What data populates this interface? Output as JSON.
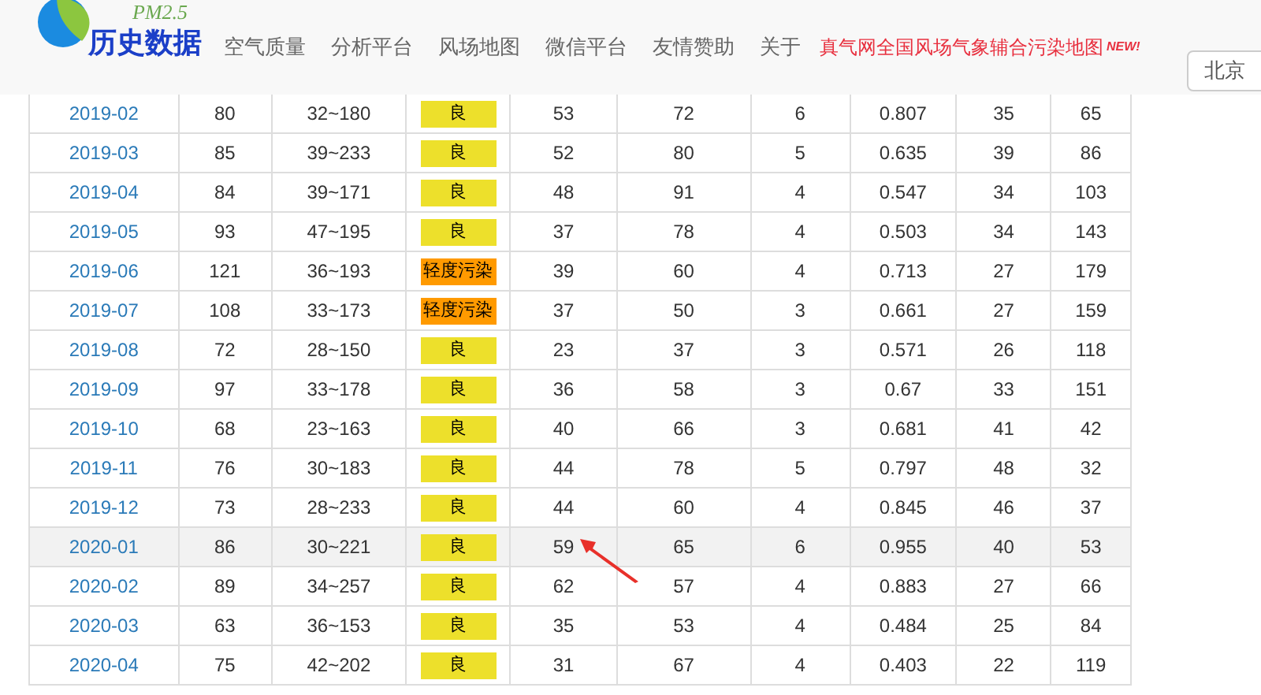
{
  "logo": {
    "caption": "PM2.5",
    "title": "历史数据"
  },
  "nav": [
    "空气质量",
    "分析平台",
    "风场地图",
    "微信平台",
    "友情赞助",
    "关于"
  ],
  "promo": {
    "text": "真气网全国风场气象辅合污染地图",
    "badge": "NEW!"
  },
  "city": {
    "value": "北京"
  },
  "rows": [
    {
      "month": "2019-02",
      "cells": [
        "80",
        "32~180",
        "53",
        "72",
        "6",
        "0.807",
        "35",
        "65"
      ],
      "quality": {
        "text": "良",
        "color": "#ede02b"
      },
      "highlighted": false
    },
    {
      "month": "2019-03",
      "cells": [
        "85",
        "39~233",
        "52",
        "80",
        "5",
        "0.635",
        "39",
        "86"
      ],
      "quality": {
        "text": "良",
        "color": "#ede02b"
      },
      "highlighted": false
    },
    {
      "month": "2019-04",
      "cells": [
        "84",
        "39~171",
        "48",
        "91",
        "4",
        "0.547",
        "34",
        "103"
      ],
      "quality": {
        "text": "良",
        "color": "#ede02b"
      },
      "highlighted": false
    },
    {
      "month": "2019-05",
      "cells": [
        "93",
        "47~195",
        "37",
        "78",
        "4",
        "0.503",
        "34",
        "143"
      ],
      "quality": {
        "text": "良",
        "color": "#ede02b"
      },
      "highlighted": false
    },
    {
      "month": "2019-06",
      "cells": [
        "121",
        "36~193",
        "39",
        "60",
        "4",
        "0.713",
        "27",
        "179"
      ],
      "quality": {
        "text": "轻度污染",
        "color": "#ff9a00"
      },
      "highlighted": false
    },
    {
      "month": "2019-07",
      "cells": [
        "108",
        "33~173",
        "37",
        "50",
        "3",
        "0.661",
        "27",
        "159"
      ],
      "quality": {
        "text": "轻度污染",
        "color": "#ff9a00"
      },
      "highlighted": false
    },
    {
      "month": "2019-08",
      "cells": [
        "72",
        "28~150",
        "23",
        "37",
        "3",
        "0.571",
        "26",
        "118"
      ],
      "quality": {
        "text": "良",
        "color": "#ede02b"
      },
      "highlighted": false
    },
    {
      "month": "2019-09",
      "cells": [
        "97",
        "33~178",
        "36",
        "58",
        "3",
        "0.67",
        "33",
        "151"
      ],
      "quality": {
        "text": "良",
        "color": "#ede02b"
      },
      "highlighted": false
    },
    {
      "month": "2019-10",
      "cells": [
        "68",
        "23~163",
        "40",
        "66",
        "3",
        "0.681",
        "41",
        "42"
      ],
      "quality": {
        "text": "良",
        "color": "#ede02b"
      },
      "highlighted": false
    },
    {
      "month": "2019-11",
      "cells": [
        "76",
        "30~183",
        "44",
        "78",
        "5",
        "0.797",
        "48",
        "32"
      ],
      "quality": {
        "text": "良",
        "color": "#ede02b"
      },
      "highlighted": false
    },
    {
      "month": "2019-12",
      "cells": [
        "73",
        "28~233",
        "44",
        "60",
        "4",
        "0.845",
        "46",
        "37"
      ],
      "quality": {
        "text": "良",
        "color": "#ede02b"
      },
      "highlighted": false
    },
    {
      "month": "2020-01",
      "cells": [
        "86",
        "30~221",
        "59",
        "65",
        "6",
        "0.955",
        "40",
        "53"
      ],
      "quality": {
        "text": "良",
        "color": "#ede02b"
      },
      "highlighted": true
    },
    {
      "month": "2020-02",
      "cells": [
        "89",
        "34~257",
        "62",
        "57",
        "4",
        "0.883",
        "27",
        "66"
      ],
      "quality": {
        "text": "良",
        "color": "#ede02b"
      },
      "highlighted": false
    },
    {
      "month": "2020-03",
      "cells": [
        "63",
        "36~153",
        "35",
        "53",
        "4",
        "0.484",
        "25",
        "84"
      ],
      "quality": {
        "text": "良",
        "color": "#ede02b"
      },
      "highlighted": false
    },
    {
      "month": "2020-04",
      "cells": [
        "75",
        "42~202",
        "31",
        "67",
        "4",
        "0.403",
        "22",
        "119"
      ],
      "quality": {
        "text": "良",
        "color": "#ede02b"
      },
      "highlighted": false
    }
  ]
}
